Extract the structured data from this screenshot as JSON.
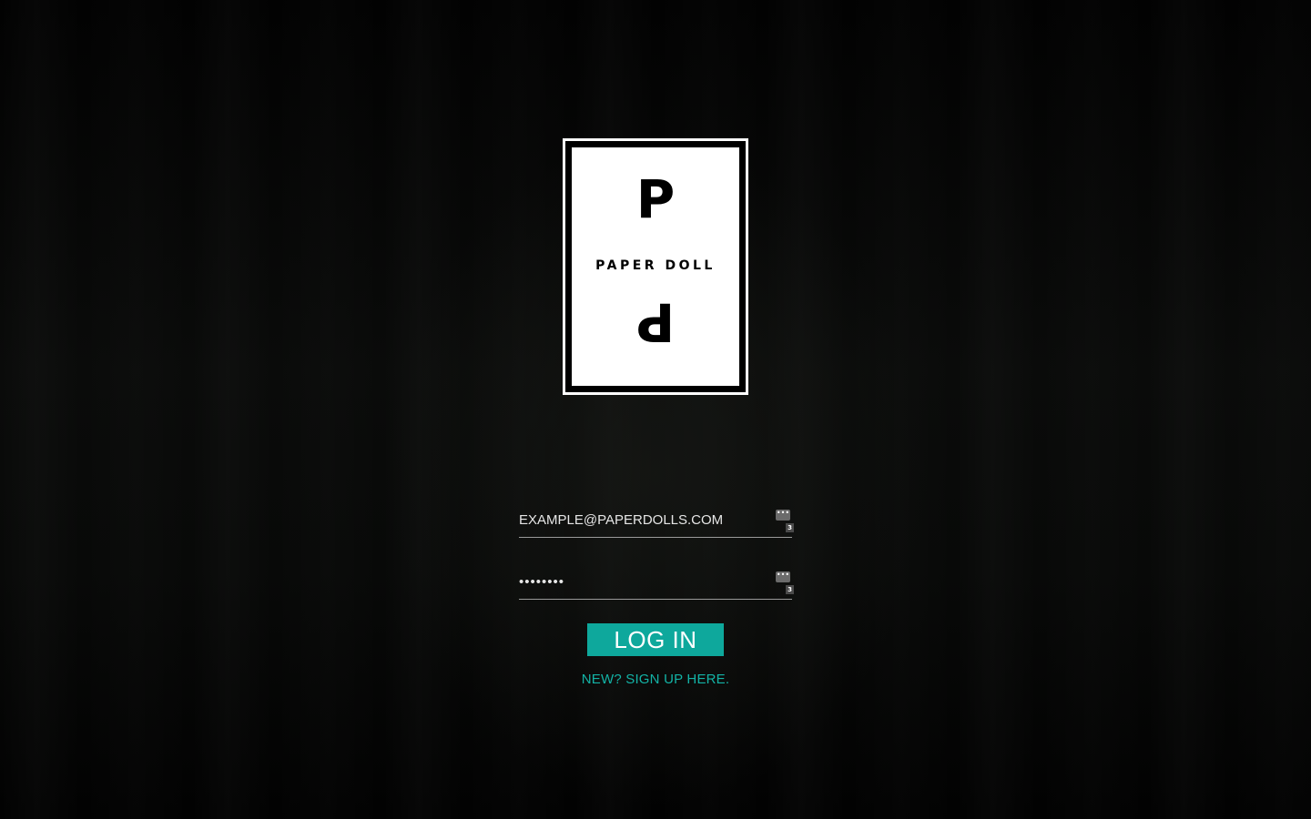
{
  "logo": {
    "top_letter": "P",
    "brand_name": "PAPER DOLL",
    "bottom_letter": "P"
  },
  "login_form": {
    "email": {
      "value": "EXAMPLE@PAPERDOLLS.COM",
      "password_manager_badge": "•••",
      "password_manager_count": "3"
    },
    "password": {
      "value": "••••••••",
      "password_manager_badge": "•••",
      "password_manager_count": "3"
    },
    "login_button_label": "LOG IN",
    "signup_link_label": "NEW? SIGN UP HERE."
  },
  "colors": {
    "accent": "#0ea89c",
    "link": "#13b3a6",
    "background": "#000000"
  }
}
